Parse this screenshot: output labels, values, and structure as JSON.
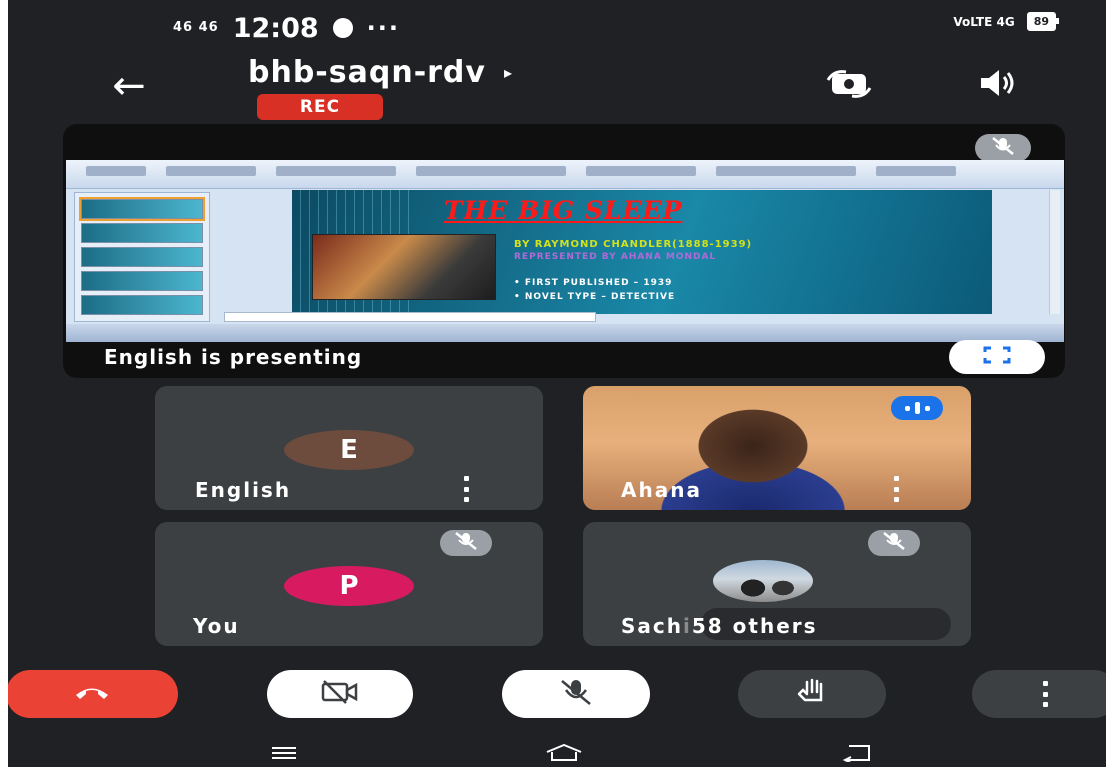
{
  "status_bar": {
    "signal_left": "46 46",
    "time": "12:08",
    "more": "···",
    "network_right": "VoLTE 4G",
    "battery": "89"
  },
  "header": {
    "meeting_code": "bhb-saqn-rdv",
    "title_arrow": "▸",
    "rec_label": "REC",
    "back_icon": "←"
  },
  "presentation": {
    "presenting_label": "English is presenting",
    "slide": {
      "title": "THE BIG SLEEP",
      "author": "BY RAYMOND CHANDLER(1888-1939)",
      "represented_by": "REPRESENTED BY AHANA MONDAL",
      "bullet_1": "•   FIRST PUBLISHED – 1939",
      "bullet_2": "•   NOVEL TYPE – DETECTIVE"
    }
  },
  "participants": [
    {
      "name": "English",
      "avatar_letter": "E",
      "avatar_color": "#6d4c3d"
    },
    {
      "name": "Ahana",
      "speaking": true
    },
    {
      "name": "You",
      "avatar_letter": "P",
      "avatar_color": "#d81b60"
    },
    {
      "name": "Sach",
      "others_label": "58 others"
    }
  ],
  "controls": {
    "end_call": "phone-hangup-icon",
    "camera": "camera-off-icon",
    "microphone": "mic-off-icon",
    "raise_hand": "hand-icon",
    "more": "more-vert-icon"
  },
  "colors": {
    "background": "#202124",
    "tile": "#3c4043",
    "end_call": "#ea4335",
    "rec": "#d93025",
    "speaking": "#1a73e8"
  }
}
